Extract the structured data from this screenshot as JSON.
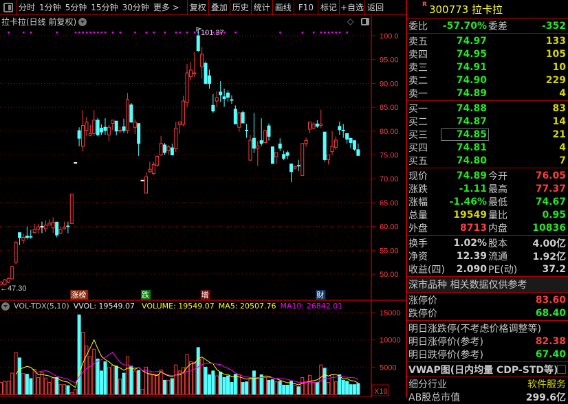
{
  "toolbar": {
    "periods": [
      "分时",
      "1分钟",
      "5分钟",
      "15分钟",
      "30分钟",
      "更多 >"
    ],
    "buttons": [
      "复权",
      "叠加",
      "历史",
      "统计",
      "画线",
      "F10",
      "标记",
      "+自选",
      "返回"
    ]
  },
  "chart": {
    "title": "拉卡拉(日线 前复权)",
    "high_label": "101.37",
    "low_label": "←47.30",
    "y_ticks": [
      "100.0",
      "95.00",
      "90.00",
      "85.00",
      "80.00",
      "75.00",
      "70.00",
      "65.00",
      "60.00",
      "55.00",
      "50.00"
    ],
    "event_tags": [
      {
        "text": "涨榜",
        "bg": "#8b2a10",
        "at": 19
      },
      {
        "text": "跌",
        "bg": "#0a7a0a",
        "at": 38
      },
      {
        "text": "增",
        "bg": "#7a0a0a",
        "at": 54
      },
      {
        "text": "财",
        "bg": "#123a6a",
        "at": 85
      }
    ],
    "colors": {
      "up": "#ff3c3c",
      "down": "#54ffff",
      "grid": "#b00000",
      "ma5": "#ffff00",
      "ma10": "#ff00ff"
    }
  },
  "chart_data": {
    "type": "candlestick",
    "ohlc": [
      [
        47.9,
        48.3,
        48.5,
        47.5
      ],
      [
        47.8,
        48.8,
        49.0,
        47.6
      ],
      [
        48.3,
        49.1,
        49.3,
        48.1
      ],
      [
        49.0,
        51.6,
        51.8,
        48.9
      ],
      [
        52.5,
        56.7,
        57.0,
        52.0
      ],
      [
        58.7,
        57.7,
        58.7,
        56.1
      ],
      [
        57.1,
        57.7,
        58.5,
        56.4
      ],
      [
        58.0,
        57.7,
        60.0,
        57.3
      ],
      [
        57.9,
        57.8,
        59.3,
        57.4
      ],
      [
        58.7,
        59.4,
        60.5,
        58.6
      ],
      [
        59.4,
        59.9,
        60.6,
        58.5
      ],
      [
        60.0,
        60.0,
        61.0,
        58.6
      ],
      [
        59.5,
        60.3,
        61.3,
        58.8
      ],
      [
        60.3,
        60.7,
        61.5,
        60.2
      ],
      [
        59.7,
        60.9,
        61.9,
        58.6
      ],
      [
        60.9,
        58.2,
        61.0,
        57.7
      ],
      [
        58.6,
        59.3,
        59.9,
        58.4
      ],
      [
        59.5,
        59.8,
        61.0,
        59.4
      ],
      [
        60.1,
        60.0,
        61.0,
        58.6
      ],
      [
        60.6,
        66.8,
        66.8,
        60.6
      ],
      [
        73.4,
        73.4,
        73.4,
        73.4
      ],
      [
        80.1,
        78.5,
        80.8,
        76.8
      ],
      [
        76.8,
        81.2,
        84.4,
        75.8
      ],
      [
        80.1,
        81.9,
        83.0,
        79.0
      ],
      [
        79.1,
        79.5,
        81.3,
        78.9
      ],
      [
        79.5,
        82.3,
        84.4,
        79.0
      ],
      [
        82.3,
        79.2,
        82.8,
        78.9
      ],
      [
        80.6,
        79.8,
        81.4,
        79.2
      ],
      [
        80.8,
        80.1,
        82.7,
        79.2
      ],
      [
        79.2,
        80.8,
        81.3,
        77.8
      ],
      [
        81.6,
        82.3,
        82.3,
        80.2
      ],
      [
        82.1,
        80.0,
        82.1,
        79.1
      ],
      [
        80.0,
        80.2,
        80.9,
        79.5
      ],
      [
        80.9,
        80.1,
        82.6,
        79.6
      ],
      [
        80.1,
        86.6,
        88.0,
        79.5
      ],
      [
        85.5,
        81.9,
        85.9,
        81.7
      ],
      [
        80.8,
        81.9,
        82.5,
        79.4
      ],
      [
        81.6,
        77.4,
        81.6,
        74.8
      ],
      [
        69.7,
        69.7,
        69.7,
        69.7
      ],
      [
        67.0,
        70.4,
        71.4,
        67.0
      ],
      [
        71.5,
        72.0,
        73.6,
        71.2
      ],
      [
        71.1,
        73.0,
        73.6,
        70.8
      ],
      [
        72.8,
        74.7,
        75.0,
        72.5
      ],
      [
        75.0,
        77.4,
        79.0,
        74.8
      ],
      [
        77.1,
        75.5,
        77.5,
        75.0
      ],
      [
        75.9,
        76.7,
        77.1,
        75.1
      ],
      [
        76.5,
        75.0,
        77.4,
        74.9
      ],
      [
        76.3,
        80.6,
        81.9,
        75.6
      ],
      [
        81.4,
        81.9,
        82.0,
        79.4
      ],
      [
        81.4,
        86.3,
        87.4,
        81.0
      ],
      [
        86.0,
        92.2,
        94.1,
        85.0
      ],
      [
        91.4,
        92.8,
        94.5,
        90.6
      ],
      [
        92.0,
        92.2,
        96.5,
        91.4
      ],
      [
        100.0,
        96.9,
        101.37,
        96.6
      ],
      [
        93.5,
        96.1,
        97.6,
        91.0
      ],
      [
        94.2,
        90.0,
        94.6,
        89.8
      ],
      [
        91.6,
        90.0,
        92.9,
        88.9
      ],
      [
        85.4,
        84.2,
        87.8,
        83.8
      ],
      [
        86.3,
        87.0,
        88.4,
        85.0
      ],
      [
        88.2,
        87.6,
        90.5,
        86.1
      ],
      [
        87.2,
        86.8,
        88.9,
        85.1
      ],
      [
        88.0,
        87.1,
        88.6,
        86.2
      ],
      [
        86.6,
        86.5,
        87.5,
        85.7
      ],
      [
        84.6,
        81.5,
        85.4,
        81.5
      ],
      [
        80.8,
        83.8,
        84.0,
        79.9
      ],
      [
        83.9,
        81.7,
        84.3,
        81.7
      ],
      [
        80.2,
        80.1,
        81.5,
        78.6
      ],
      [
        73.9,
        78.1,
        79.2,
        73.9
      ],
      [
        78.5,
        76.4,
        83.8,
        75.4
      ],
      [
        76.4,
        76.9,
        77.9,
        72.7
      ],
      [
        78.0,
        77.4,
        82.7,
        76.9
      ],
      [
        77.6,
        80.1,
        80.2,
        77.6
      ],
      [
        81.1,
        78.9,
        81.6,
        78.0
      ],
      [
        76.7,
        73.2,
        76.7,
        73.2
      ],
      [
        74.6,
        75.5,
        75.5,
        73.1
      ],
      [
        77.3,
        76.4,
        78.5,
        75.8
      ],
      [
        75.1,
        74.3,
        75.9,
        73.9
      ],
      [
        75.5,
        74.9,
        75.9,
        74.1
      ],
      [
        73.1,
        71.5,
        73.1,
        69.3
      ],
      [
        72.2,
        72.5,
        72.8,
        71.9
      ],
      [
        72.8,
        72.7,
        74.0,
        71.6
      ],
      [
        70.7,
        77.4,
        77.5,
        70.7
      ],
      [
        77.4,
        78.0,
        78.6,
        76.7
      ],
      [
        80.4,
        81.9,
        81.9,
        79.5
      ],
      [
        80.6,
        81.5,
        81.8,
        80.4
      ],
      [
        81.5,
        81.0,
        82.3,
        80.7
      ],
      [
        81.2,
        81.5,
        84.5,
        80.6
      ],
      [
        79.8,
        74.0,
        79.8,
        73.6
      ],
      [
        74.0,
        75.0,
        75.0,
        73.0
      ],
      [
        75.7,
        76.8,
        80.0,
        75.0
      ],
      [
        76.6,
        78.1,
        78.9,
        76.1
      ],
      [
        81.0,
        80.3,
        82.0,
        79.2
      ],
      [
        80.2,
        80.1,
        81.5,
        78.6
      ],
      [
        79.5,
        78.3,
        79.5,
        77.4
      ],
      [
        78.5,
        77.6,
        78.5,
        76.4
      ],
      [
        78.0,
        76.2,
        78.0,
        75.9
      ],
      [
        76.1,
        74.89,
        77.4,
        74.8
      ]
    ],
    "volume": [
      2200,
      2400,
      2400,
      3900,
      7650,
      6700,
      3800,
      3700,
      2900,
      4600,
      3100,
      4000,
      3000,
      2200,
      3000,
      3100,
      1800,
      1800,
      1600,
      300,
      900,
      14600,
      11400,
      8900,
      6900,
      8300,
      6500,
      4300,
      6000,
      4900,
      5300,
      5200,
      2800,
      3900,
      6900,
      5200,
      4300,
      4400,
      900,
      5000,
      3900,
      3700,
      3700,
      4500,
      2600,
      2600,
      2900,
      5400,
      4300,
      4900,
      7300,
      6000,
      5900,
      8600,
      6500,
      5000,
      3600,
      4300,
      3400,
      4100,
      3100,
      3400,
      2200,
      3700,
      3600,
      2200,
      2300,
      2800,
      4300,
      3100,
      3600,
      3100,
      2600,
      2700,
      2300,
      2400,
      1700,
      1700,
      2400,
      1600,
      1400,
      3100,
      2400,
      3500,
      2200,
      2200,
      5400,
      4800,
      2200,
      3600,
      2300,
      3600,
      2600,
      2400,
      1800,
      1800,
      2000
    ],
    "marker_indices": [
      2,
      6,
      8,
      15,
      20,
      21,
      22,
      23,
      24,
      25,
      26,
      27,
      28,
      30,
      32,
      36,
      39,
      41,
      44,
      47,
      48,
      50,
      52,
      53,
      55,
      57,
      58,
      59,
      60,
      63,
      75,
      81,
      84,
      86,
      87,
      88,
      89,
      90,
      91,
      93
    ],
    "ylim": [
      45.5,
      103
    ],
    "vol_ticks": [
      "15000",
      "10000",
      "5000"
    ],
    "vol_unit": "X10"
  },
  "volume_legend": {
    "name": "VOL-TDX(5,10)",
    "vvol": "VVOL: 19549.07",
    "volume": "VOLUME: 19549.07",
    "ma5": "MA5: 20507.76",
    "ma10": "MA10: 26842.01"
  },
  "quote": {
    "code": "300773 拉卡拉",
    "r": "R",
    "wb": {
      "l1": "委比",
      "v1": "-57.70%",
      "l2": "委差",
      "v2": "-352"
    },
    "asks": [
      {
        "l": "卖五",
        "p": "74.97",
        "v": "133"
      },
      {
        "l": "卖四",
        "p": "74.95",
        "v": "105"
      },
      {
        "l": "卖三",
        "p": "74.91",
        "v": "10"
      },
      {
        "l": "卖二",
        "p": "74.90",
        "v": "229"
      },
      {
        "l": "卖一",
        "p": "74.89",
        "v": "4"
      }
    ],
    "bids": [
      {
        "l": "买一",
        "p": "74.88",
        "v": "83"
      },
      {
        "l": "买二",
        "p": "74.87",
        "v": "14"
      },
      {
        "l": "买三",
        "p": "74.85",
        "v": "21"
      },
      {
        "l": "买四",
        "p": "74.81",
        "v": "4"
      },
      {
        "l": "买五",
        "p": "74.80",
        "v": "7"
      }
    ],
    "stats": [
      {
        "l1": "现价",
        "v1": "74.89",
        "c1": "g",
        "l2": "今开",
        "v2": "76.05",
        "c2": "rd"
      },
      {
        "l1": "涨跌",
        "v1": "-1.11",
        "c1": "g",
        "l2": "最高",
        "v2": "77.37",
        "c2": "rd"
      },
      {
        "l1": "涨幅",
        "v1": "-1.46%",
        "c1": "g",
        "l2": "最低",
        "v2": "74.67",
        "c2": "g"
      },
      {
        "l1": "总量",
        "v1": "19549",
        "c1": "y",
        "l2": "量比",
        "v2": "0.95",
        "c2": "g"
      },
      {
        "l1": "外盘",
        "v1": "8713",
        "c1": "rd",
        "l2": "内盘",
        "v2": "10836",
        "c2": "g"
      }
    ],
    "fund": [
      {
        "l1": "换手",
        "v1": "1.02%",
        "l2": "股本",
        "v2": "4.00亿"
      },
      {
        "l1": "净资",
        "v1": "12.39",
        "l2": "流通",
        "v2": "1.92亿"
      },
      {
        "l1": "收益(四)",
        "v1": "2.090",
        "l2": "PE(动)",
        "v2": "37.2"
      }
    ],
    "market_note": "深市品种  相关数据仅供参考",
    "limit_up_label": "涨停价",
    "limit_up": "83.60",
    "limit_down_label": "跌停价",
    "limit_down": "68.40",
    "tomorrow_title": "明日涨跌停(不考虑价格调整等)",
    "tomorrow_up_label": "明日涨停价(参考)",
    "tomorrow_up": "82.38",
    "tomorrow_down_label": "明日跌停价(参考)",
    "tomorrow_down": "67.40",
    "vwap": "VWAP图(日内均量 CDP-STD等)",
    "industry_label": "细分行业",
    "industry": "软件服务",
    "mcap_label": "AB股总市值",
    "mcap": "299.6亿"
  }
}
